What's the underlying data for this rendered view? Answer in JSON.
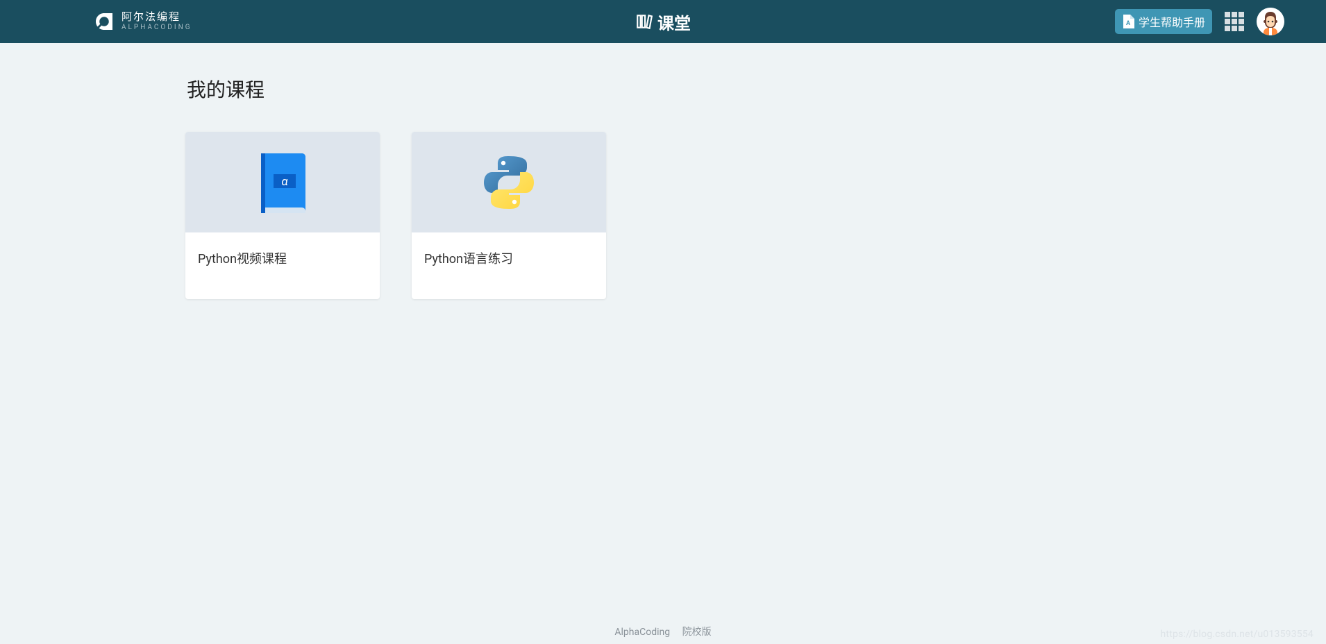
{
  "header": {
    "logo_cn": "阿尔法编程",
    "logo_en": "ALPHACODING",
    "center_title": "课堂",
    "help_label": "学生帮助手册"
  },
  "section_title": "我的课程",
  "courses": [
    {
      "title": "Python视频课程"
    },
    {
      "title": "Python语言练习"
    }
  ],
  "footer": {
    "brand": "AlphaCoding",
    "edition": "院校版"
  },
  "watermark": "https://blog.csdn.net/u013593554"
}
